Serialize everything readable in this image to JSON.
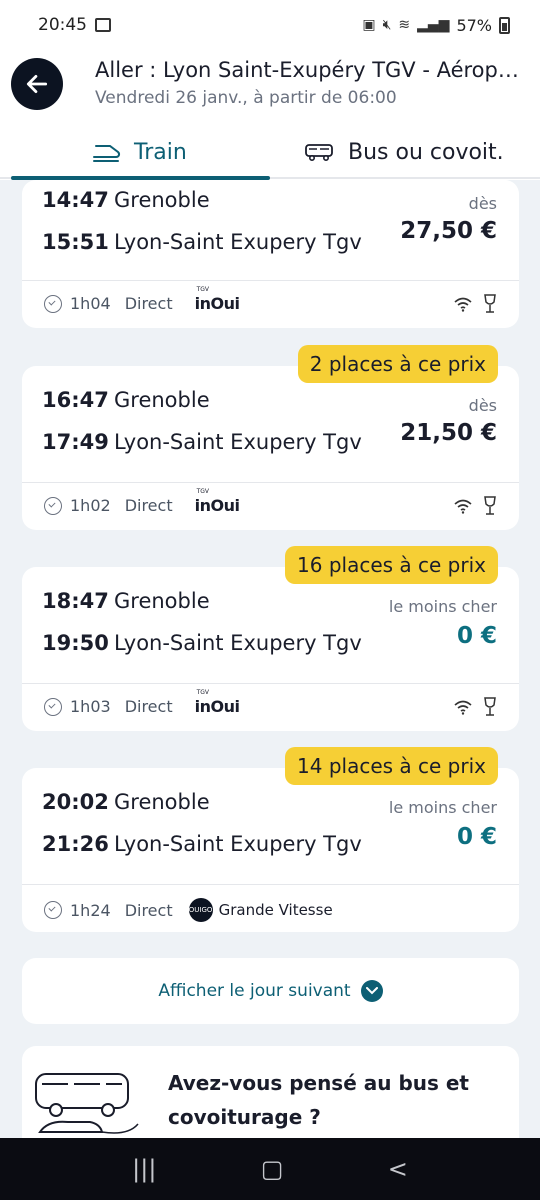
{
  "status_bar": {
    "time": "20:45",
    "battery": "57%"
  },
  "header": {
    "title": "Aller : Lyon Saint-Exupéry TGV - Aéroport",
    "subtitle": "Vendredi 26 janv., à partir de 06:00"
  },
  "tabs": [
    {
      "label": "Train",
      "selected": true,
      "icon": "train-icon"
    },
    {
      "label": "Bus ou covoit.",
      "selected": false,
      "icon": "bus-car-icon"
    }
  ],
  "trips": [
    {
      "dep_time": "14:47",
      "dep_station": "Grenoble",
      "arr_time": "15:51",
      "arr_station": "Lyon-Saint Exupery Tgv",
      "price_label": "dès",
      "price": "27,50 €",
      "duration": "1h04",
      "type": "Direct",
      "operator": "inoui",
      "badge": ""
    },
    {
      "dep_time": "16:47",
      "dep_station": "Grenoble",
      "arr_time": "17:49",
      "arr_station": "Lyon-Saint Exupery Tgv",
      "price_label": "dès",
      "price": "21,50 €",
      "duration": "1h02",
      "type": "Direct",
      "operator": "inoui",
      "badge": "2 places à ce prix"
    },
    {
      "dep_time": "18:47",
      "dep_station": "Grenoble",
      "arr_time": "19:50",
      "arr_station": "Lyon-Saint Exupery Tgv",
      "price_label": "le moins cher",
      "price": "0 €",
      "duration": "1h03",
      "type": "Direct",
      "operator": "inoui",
      "badge": "16 places à ce prix"
    },
    {
      "dep_time": "20:02",
      "dep_station": "Grenoble",
      "arr_time": "21:26",
      "arr_station": "Lyon-Saint Exupery Tgv",
      "price_label": "le moins cher",
      "price": "0 €",
      "duration": "1h24",
      "type": "Direct",
      "operator": "ouigo",
      "badge": "14 places à ce prix"
    }
  ],
  "operators": {
    "inoui_small": "TGV",
    "inoui_name": "inOui",
    "ouigo_logo": "OUIGO",
    "ouigo_name": "Grande Vitesse"
  },
  "next_day": {
    "label": "Afficher le jour suivant"
  },
  "promo": {
    "line1": "Avez-vous pensé au bus et",
    "line2": "covoiturage ?"
  },
  "colors": {
    "accent": "#0d5f74",
    "badge": "#f6cf35",
    "cheap_price": "#0d6f80",
    "nav": "#0b0c12"
  }
}
